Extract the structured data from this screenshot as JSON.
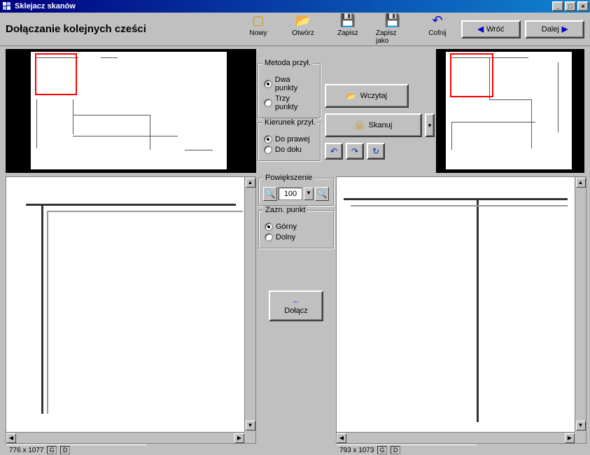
{
  "window": {
    "title": "Sklejacz skanów"
  },
  "heading": "Dołączanie kolejnych cześci",
  "toolbar": {
    "nowy": "Nowy",
    "otworz": "Otwórz",
    "zapisz": "Zapisz",
    "zapisz_jako": "Zapisz jako",
    "cofnij": "Cofnij",
    "wroc": "Wróć",
    "dalej": "Dalej"
  },
  "metoda": {
    "title": "Metoda przył.",
    "dwa": "Dwa punkty",
    "trzy": "Trzy punkty",
    "selected": "dwa"
  },
  "kierunek": {
    "title": "Kierunek przył.",
    "prawej": "Do prawej",
    "dolu": "Do dołu",
    "selected": "prawej"
  },
  "buttons": {
    "wczytaj": "Wczytaj",
    "skanuj": "Skanuj",
    "dolacz": "Dołącz"
  },
  "zoom": {
    "title": "Powiększenie",
    "value": "100"
  },
  "zazn": {
    "title": "Zazn. punkt",
    "gorny": "Górny",
    "dolny": "Dolny",
    "selected": "gorny"
  },
  "status": {
    "left": "776 x 1077",
    "right": "793 x 1073"
  },
  "icons": {
    "nowy": "new-icon",
    "otworz": "open-icon",
    "zapisz": "save-icon",
    "zapisz_jako": "saveas-icon",
    "cofnij": "undo-icon",
    "wczytaj": "folder-icon",
    "skanuj": "scanner-icon"
  },
  "colors": {
    "accent": "#000080",
    "selection": "#ff0000"
  }
}
